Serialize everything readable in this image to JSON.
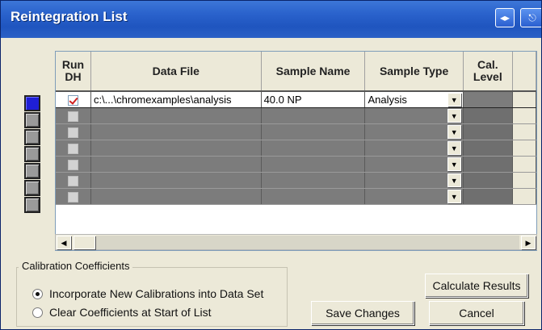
{
  "window": {
    "title": "Reintegration List"
  },
  "titlebar": {
    "restore_glyph": "◆",
    "close_glyph": "→"
  },
  "grid": {
    "columns": [
      "Run DH",
      "Data File",
      "Sample Name",
      "Sample Type",
      "Cal. Level"
    ],
    "rows": [
      {
        "run_dh": true,
        "data_file": "c:\\...\\chromexamples\\analysis",
        "sample_name": "40.0 NP",
        "sample_type": "Analysis",
        "cal_level": ""
      },
      {
        "run_dh": false,
        "data_file": "",
        "sample_name": "",
        "sample_type": "",
        "cal_level": ""
      },
      {
        "run_dh": false,
        "data_file": "",
        "sample_name": "",
        "sample_type": "",
        "cal_level": ""
      },
      {
        "run_dh": false,
        "data_file": "",
        "sample_name": "",
        "sample_type": "",
        "cal_level": ""
      },
      {
        "run_dh": false,
        "data_file": "",
        "sample_name": "",
        "sample_type": "",
        "cal_level": ""
      },
      {
        "run_dh": false,
        "data_file": "",
        "sample_name": "",
        "sample_type": "",
        "cal_level": ""
      },
      {
        "run_dh": false,
        "data_file": "",
        "sample_name": "",
        "sample_type": "",
        "cal_level": ""
      },
      {
        "run_dh": false,
        "data_file": "",
        "sample_name": "",
        "sample_type": "",
        "cal_level": ""
      }
    ],
    "selected_row": 0
  },
  "calibration": {
    "group_label": "Calibration Coefficients",
    "options": [
      {
        "label": "Incorporate New Calibrations into Data Set",
        "selected": true
      },
      {
        "label": "Clear Coefficients at Start of List",
        "selected": false
      }
    ]
  },
  "buttons": {
    "calculate": "Calculate Results",
    "save": "Save Changes",
    "cancel": "Cancel"
  },
  "colors": {
    "titlebar": "#2a62cc",
    "selector_active": "#1f1fd6",
    "check_mark": "#d02020",
    "empty_cell": "#7c7c7c"
  }
}
